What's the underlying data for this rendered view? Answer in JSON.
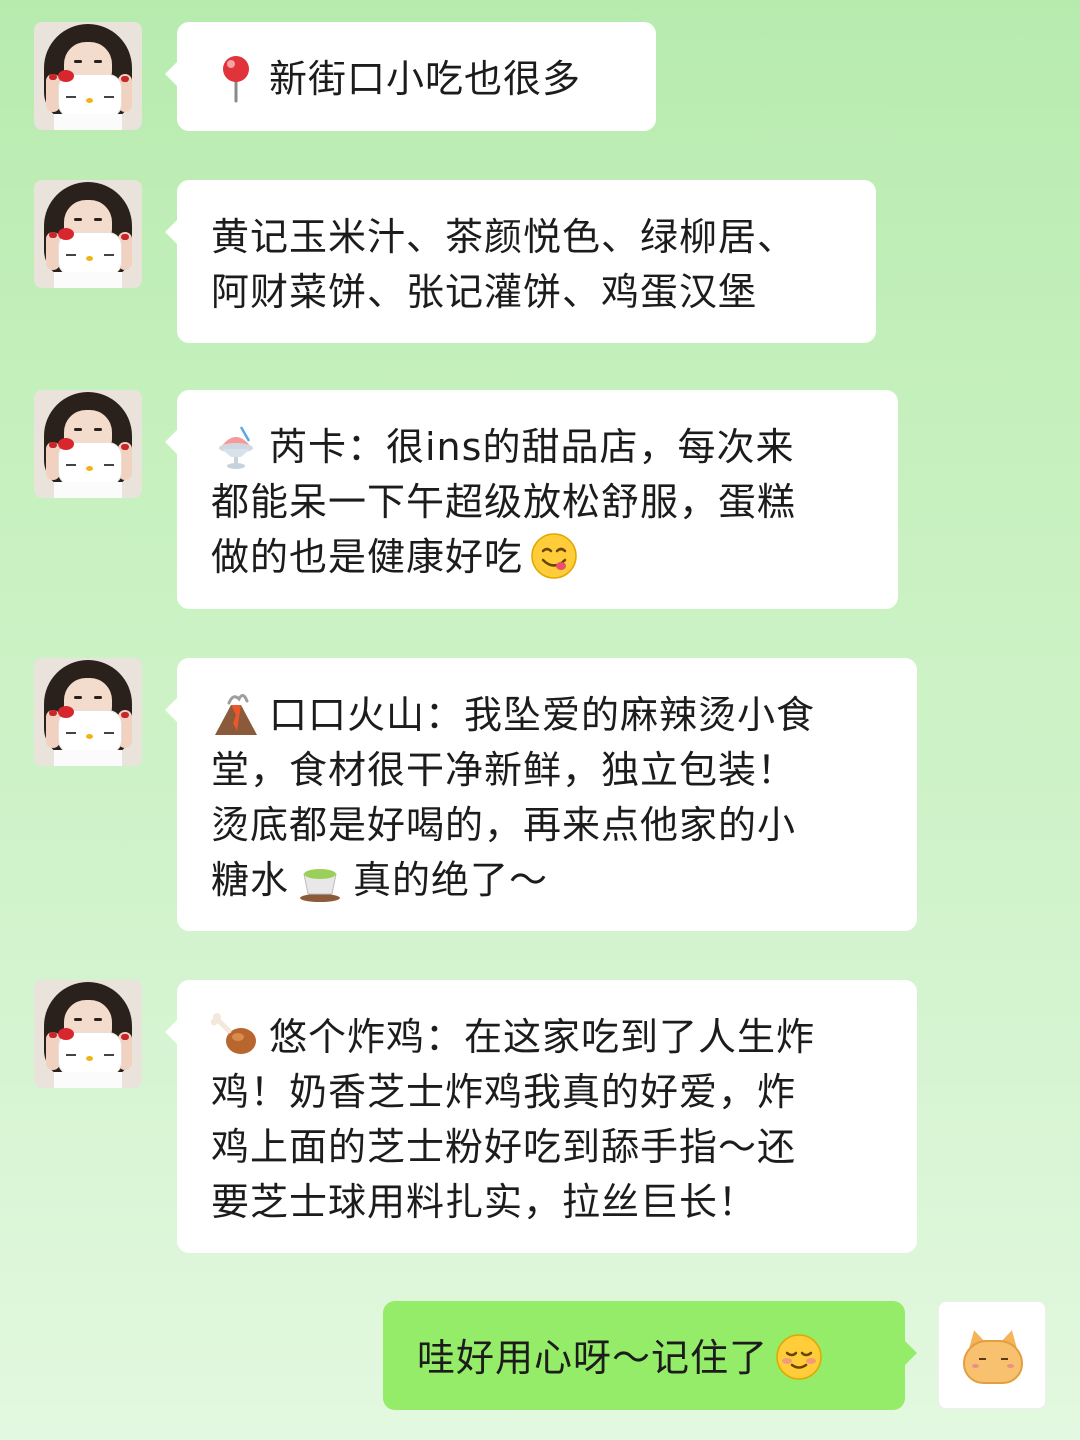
{
  "messages": [
    {
      "sender": "other",
      "icon": "round-pushpin",
      "lines": [
        "新街口小吃也很多"
      ]
    },
    {
      "sender": "other",
      "lines": [
        "黄记玉米汁、茶颜悦色、绿柳居、",
        "阿财菜饼、张记灌饼、鸡蛋汉堡"
      ]
    },
    {
      "sender": "other",
      "icon": "shaved-ice",
      "lines": [
        "芮卡：很ins的甜品店，每次来",
        "都能呆一下午超级放松舒服，蛋糕",
        "做的也是健康好吃"
      ],
      "trailing_icon": "face-savoring-food"
    },
    {
      "sender": "other",
      "icon": "volcano",
      "lines": [
        "口口火山：我坠爱的麻辣烫小食",
        "堂，食材很干净新鲜，独立包装！",
        "烫底都是好喝的，再来点他家的小"
      ],
      "last_line_pre": "糖水",
      "inline_icon": "teacup-without-handle",
      "last_line_post": "真的绝了～"
    },
    {
      "sender": "other",
      "icon": "poultry-leg",
      "lines": [
        "悠个炸鸡：在这家吃到了人生炸",
        "鸡！奶香芝士炸鸡我真的好爱，炸",
        "鸡上面的芝士粉好吃到舔手指～还",
        "要芝士球用料扎实，拉丝巨长！"
      ]
    },
    {
      "sender": "me",
      "text": "哇好用心呀～记住了",
      "trailing_icon": "smiling-face"
    }
  ],
  "colors": {
    "my_bubble": "#95ec69",
    "other_bubble": "#ffffff",
    "background_top": "#b7ebae",
    "background_bottom": "#e3f8e0"
  }
}
